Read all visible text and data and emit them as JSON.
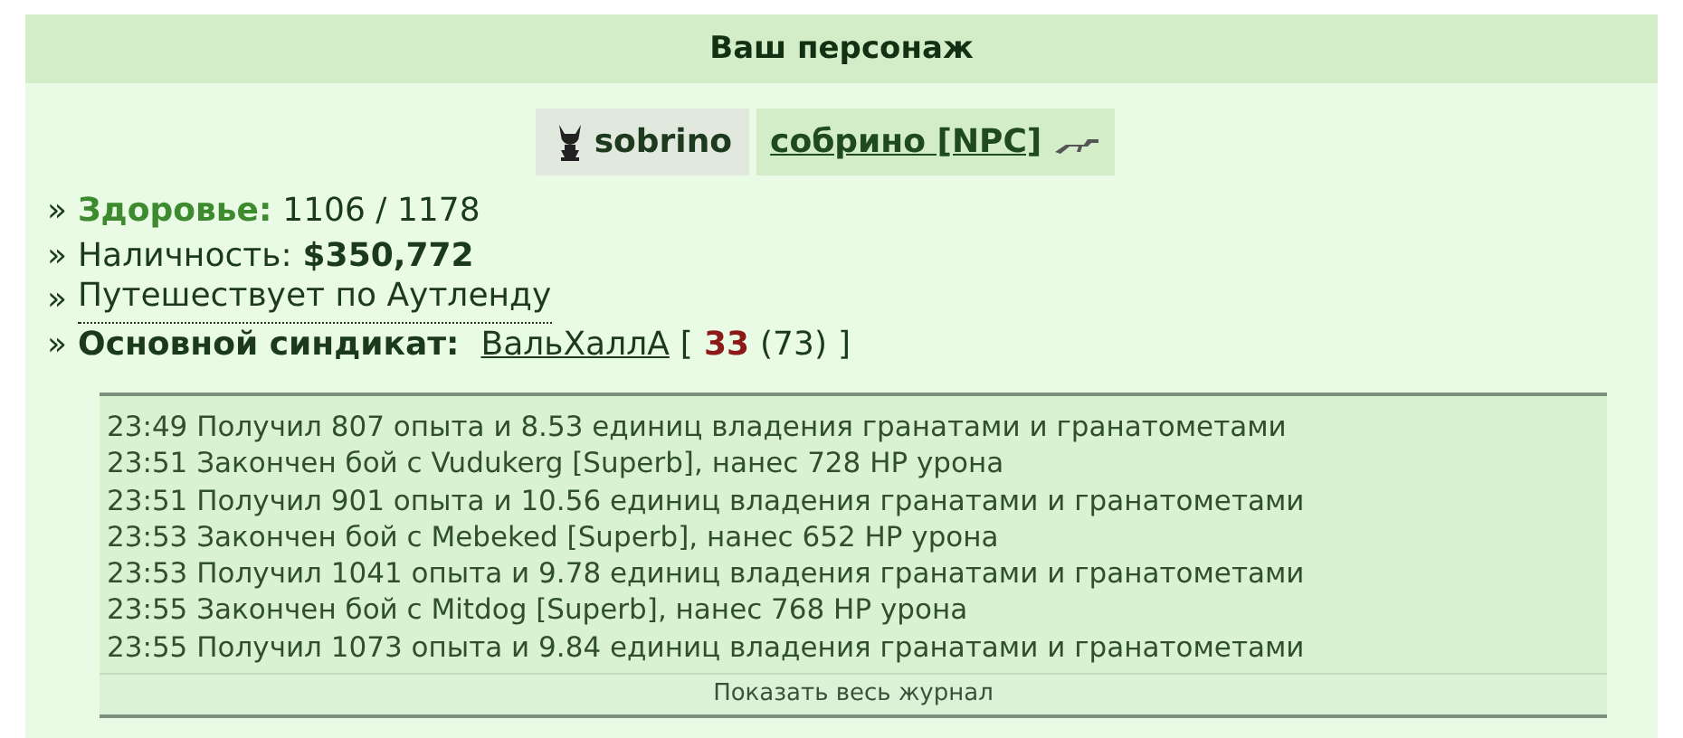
{
  "header": {
    "title": "Ваш персонаж"
  },
  "player": {
    "login": "sobrino",
    "character": "собрино [NPC]"
  },
  "stats": [
    {
      "kind": "health",
      "bullet": "»",
      "label": "Здоровье:",
      "value": "1106 / 1178"
    },
    {
      "kind": "cash",
      "bullet": "»",
      "label": "Наличность:",
      "value": "$350,772"
    },
    {
      "kind": "link",
      "bullet": "»",
      "text": "Путешествует по Аутленду"
    },
    {
      "kind": "syndicate",
      "bullet": "»",
      "label": "Основной синдикат:",
      "name": "ВальХаллА",
      "open": "[",
      "rank": "33",
      "total": "(73)",
      "close": "]"
    }
  ],
  "log": {
    "entries": [
      {
        "time": "23:49",
        "text": "Получил 807 опыта и 8.53 единиц владения гранатами и гранатометами"
      },
      {
        "time": "23:51",
        "text": "Закончен бой с Vudukerg [Superb], нанес 728 HP урона"
      },
      {
        "time": "23:51",
        "text": "Получил 901 опыта и 10.56 единиц владения гранатами и гранатометами"
      },
      {
        "time": "23:53",
        "text": "Закончен бой с Mebeked [Superb], нанес 652 HP урона"
      },
      {
        "time": "23:53",
        "text": "Получил 1041 опыта и 9.78 единиц владения гранатами и гранатометами"
      },
      {
        "time": "23:55",
        "text": "Закончен бой с Mitdog [Superb], нанес 768 HP урона"
      },
      {
        "time": "23:55",
        "text": "Получил 1073 опыта и 9.84 единиц владения гранатами и гранатометами"
      }
    ],
    "footer": "Показать весь журнал"
  }
}
